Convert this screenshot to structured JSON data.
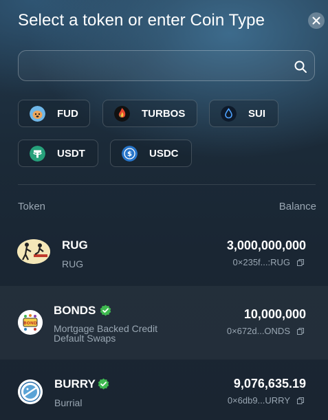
{
  "modal": {
    "title": "Select a token or enter Coin Type",
    "search": {
      "value": "",
      "placeholder": ""
    }
  },
  "quick_tokens": [
    {
      "label": "FUD",
      "icon": "fud-dog-icon"
    },
    {
      "label": "TURBOS",
      "icon": "turbos-flame-icon"
    },
    {
      "label": "SUI",
      "icon": "sui-droplet-icon"
    },
    {
      "label": "USDT",
      "icon": "tether-icon"
    },
    {
      "label": "USDC",
      "icon": "usdc-icon"
    }
  ],
  "list_header": {
    "token": "Token",
    "balance": "Balance"
  },
  "tokens": [
    {
      "symbol": "RUG",
      "name": "RUG",
      "verified": false,
      "balance": "3,000,000,000",
      "address": "0×235f...:RUG"
    },
    {
      "symbol": "BONDS",
      "name_line1": "Mortgage Backed Credit",
      "name_line2": "Default Swaps",
      "verified": true,
      "balance": "10,000,000",
      "address": "0×672d...ONDS"
    },
    {
      "symbol": "BURRY",
      "name": "Burrial",
      "verified": true,
      "balance": "9,076,635.19",
      "address": "0×6db9...URRY"
    }
  ],
  "colors": {
    "verified": "#3fb950",
    "muted_text": "#9aa7b3"
  }
}
